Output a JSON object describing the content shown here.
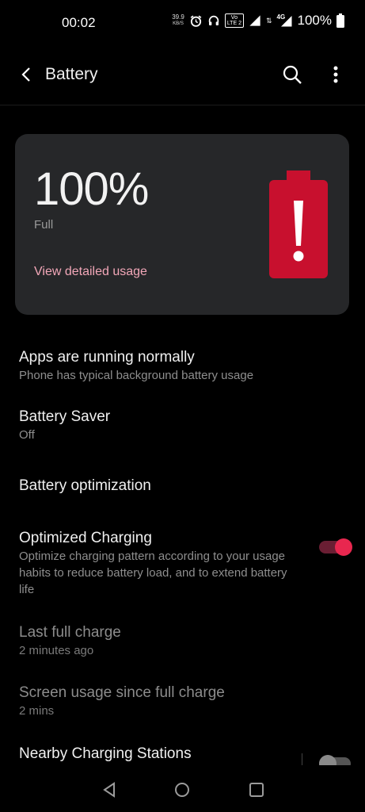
{
  "status_bar": {
    "time": "00:02",
    "net_speed_value": "39.9",
    "net_speed_unit": "KB/S",
    "volte_label_top": "Vo",
    "volte_label_bottom": "LTE 2",
    "network_type": "4G",
    "battery_percent": "100%"
  },
  "app_bar": {
    "title": "Battery"
  },
  "battery_card": {
    "level": "100%",
    "status": "Full",
    "link": "View detailed usage",
    "graphic_color": "#c8102e"
  },
  "items": [
    {
      "title": "Apps are running normally",
      "subtitle": "Phone has typical background battery usage"
    },
    {
      "title": "Battery Saver",
      "subtitle": "Off"
    },
    {
      "title": "Battery optimization"
    },
    {
      "title": "Optimized Charging",
      "subtitle": "Optimize charging pattern according to your usage habits to reduce battery load, and to extend battery life",
      "toggle": "on"
    },
    {
      "title": "Last full charge",
      "subtitle": "2 minutes ago"
    },
    {
      "title": "Screen usage since full charge",
      "subtitle": "2 mins"
    },
    {
      "title": "Nearby Charging Stations",
      "toggle": "off"
    }
  ],
  "colors": {
    "accent": "#e8274f",
    "link": "#f2a7b8",
    "card_bg": "#262729"
  }
}
